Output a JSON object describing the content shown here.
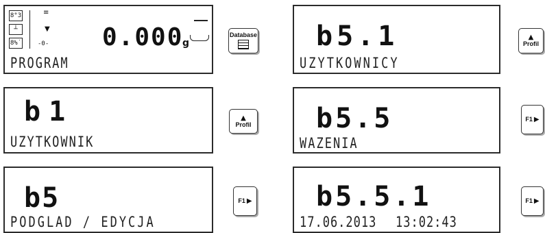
{
  "screens": [
    {
      "main": "0.000",
      "unit": "g",
      "label": "PROGRAM",
      "zero_mark": "-0-",
      "icons": [
        "8°3",
        "8%˙"
      ]
    },
    {
      "main": "b1",
      "label": "UZYTKOWNIK"
    },
    {
      "main": "b5",
      "label": "PODGLAD / EDYCJA"
    },
    {
      "main": "b5.1",
      "label": "UZYTKOWNICY"
    },
    {
      "main": "b5.5",
      "label": "WAZENIA"
    },
    {
      "main": "b5.5.1",
      "date": "17.06.2013",
      "time": "13:02:43"
    }
  ],
  "buttons": {
    "database": "Database",
    "profil": "Profil",
    "f1": "F1"
  }
}
